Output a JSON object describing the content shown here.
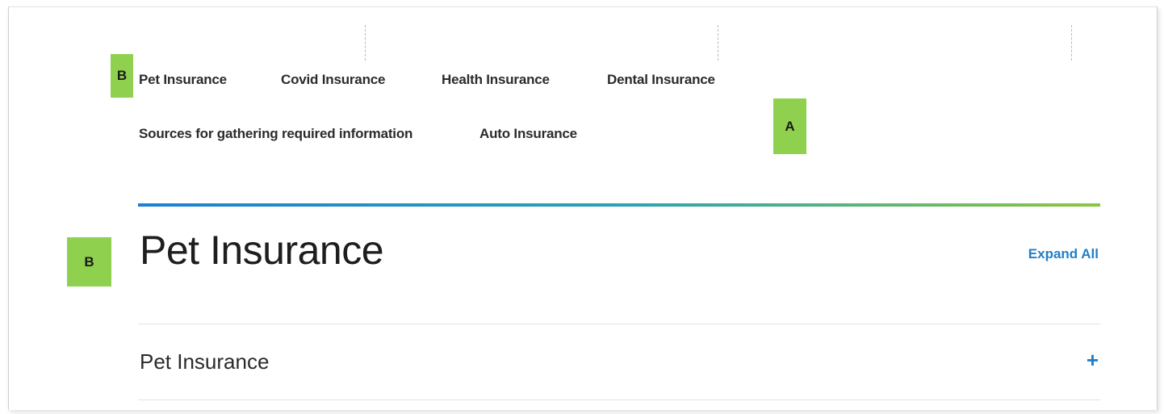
{
  "nav": {
    "row1": [
      "Pet Insurance",
      "Covid Insurance",
      "Health Insurance",
      "Dental Insurance"
    ],
    "row2": [
      "Sources for gathering required information",
      "Auto Insurance"
    ]
  },
  "markers": {
    "b_top": "B",
    "a": "A",
    "b_title": "B"
  },
  "section": {
    "title": "Pet Insurance",
    "expand_all": "Expand All"
  },
  "accordion": [
    {
      "label": "Pet Insurance",
      "toggle": "+"
    }
  ],
  "colors": {
    "accent": "#1f7fc9",
    "marker": "#8fd14f",
    "gradient_start": "#1f7fd1",
    "gradient_end": "#8dc63f"
  }
}
